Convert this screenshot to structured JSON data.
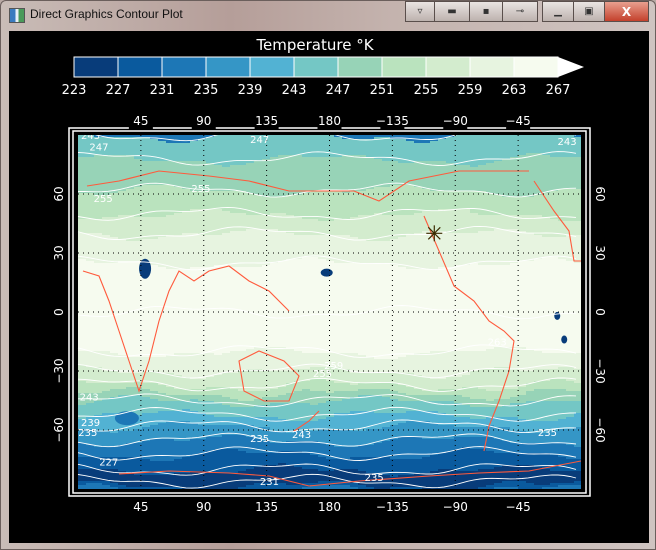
{
  "window": {
    "title": "Direct Graphics Contour Plot",
    "buttons": [
      {
        "name": "menu-button",
        "icon": "triangle-down-icon",
        "glyph": "▿"
      },
      {
        "name": "toolbar-button",
        "icon": "dash-icon",
        "glyph": "▬"
      },
      {
        "name": "dot-button",
        "icon": "dot-icon",
        "glyph": "▪"
      },
      {
        "name": "pin-button",
        "icon": "pin-icon",
        "glyph": "⊸"
      },
      {
        "name": "minimize-button",
        "icon": "minimize-icon",
        "glyph": "▁"
      },
      {
        "name": "maximize-button",
        "icon": "maximize-icon",
        "glyph": "▣"
      },
      {
        "name": "close-button",
        "icon": "close-icon",
        "glyph": "X"
      }
    ]
  },
  "colorbar": {
    "title": "Temperature  °K",
    "levels": [
      "223",
      "227",
      "231",
      "235",
      "239",
      "243",
      "247",
      "251",
      "255",
      "259",
      "263",
      "267"
    ],
    "colors": [
      "#083c7a",
      "#0a5a9e",
      "#1d77b6",
      "#3596c6",
      "#52b2d3",
      "#74c7c5",
      "#97d3b7",
      "#bae3be",
      "#d3ecce",
      "#e7f4e0",
      "#f6fbef"
    ],
    "overflow_color": "#ffffff"
  },
  "chart_data": {
    "type": "contour",
    "title": "Temperature  °K",
    "x_ticks": [
      "45",
      "90",
      "135",
      "180",
      "−135",
      "−90",
      "−45"
    ],
    "x_tick_values": [
      45,
      90,
      135,
      180,
      225,
      270,
      315
    ],
    "y_ticks": [
      "60",
      "30",
      "0",
      "−30",
      "−60"
    ],
    "y_tick_values": [
      60,
      30,
      0,
      -30,
      -60
    ],
    "xlim": [
      0,
      360
    ],
    "ylim": [
      -90,
      90
    ],
    "grid": true,
    "coastline_color": "#ff5a3c",
    "contour_line_color": "#ffffff",
    "zonal_profile": [
      {
        "lat": 90,
        "value": 243
      },
      {
        "lat": 78,
        "value": 247
      },
      {
        "lat": 62,
        "value": 251
      },
      {
        "lat": 50,
        "value": 255
      },
      {
        "lat": 40,
        "value": 259
      },
      {
        "lat": 25,
        "value": 263
      },
      {
        "lat": 0,
        "value": 267
      },
      {
        "lat": -20,
        "value": 263
      },
      {
        "lat": -30,
        "value": 259
      },
      {
        "lat": -37,
        "value": 255
      },
      {
        "lat": -45,
        "value": 247
      },
      {
        "lat": -52,
        "value": 243
      },
      {
        "lat": -58,
        "value": 239
      },
      {
        "lat": -65,
        "value": 235
      },
      {
        "lat": -72,
        "value": 231
      },
      {
        "lat": -80,
        "value": 227
      },
      {
        "lat": -86,
        "value": 223
      },
      {
        "lat": -90,
        "value": 231
      }
    ],
    "contour_labels": [
      {
        "text": "243",
        "lon": 9,
        "lat": 88
      },
      {
        "text": "247",
        "lon": 15,
        "lat": 82
      },
      {
        "text": "247",
        "lon": 130,
        "lat": 86
      },
      {
        "text": "243",
        "lon": 350,
        "lat": 85
      },
      {
        "text": "255",
        "lon": 18,
        "lat": 56
      },
      {
        "text": "255",
        "lon": 88,
        "lat": 61
      },
      {
        "text": "263",
        "lon": 300,
        "lat": -17
      },
      {
        "text": "259",
        "lon": 183,
        "lat": -29
      },
      {
        "text": "255",
        "lon": 175,
        "lat": -33
      },
      {
        "text": "243",
        "lon": 8,
        "lat": -45
      },
      {
        "text": "239",
        "lon": 9,
        "lat": -58
      },
      {
        "text": "235",
        "lon": 7,
        "lat": -63
      },
      {
        "text": "227",
        "lon": 22,
        "lat": -78
      },
      {
        "text": "231",
        "lon": 137,
        "lat": -88
      },
      {
        "text": "243",
        "lon": 160,
        "lat": -64
      },
      {
        "text": "235",
        "lon": 130,
        "lat": -66
      },
      {
        "text": "235",
        "lon": 212,
        "lat": -86
      },
      {
        "text": "235",
        "lon": 336,
        "lat": -63
      }
    ],
    "marker": {
      "symbol": "asterisk",
      "lon": 255,
      "lat": 40
    }
  }
}
